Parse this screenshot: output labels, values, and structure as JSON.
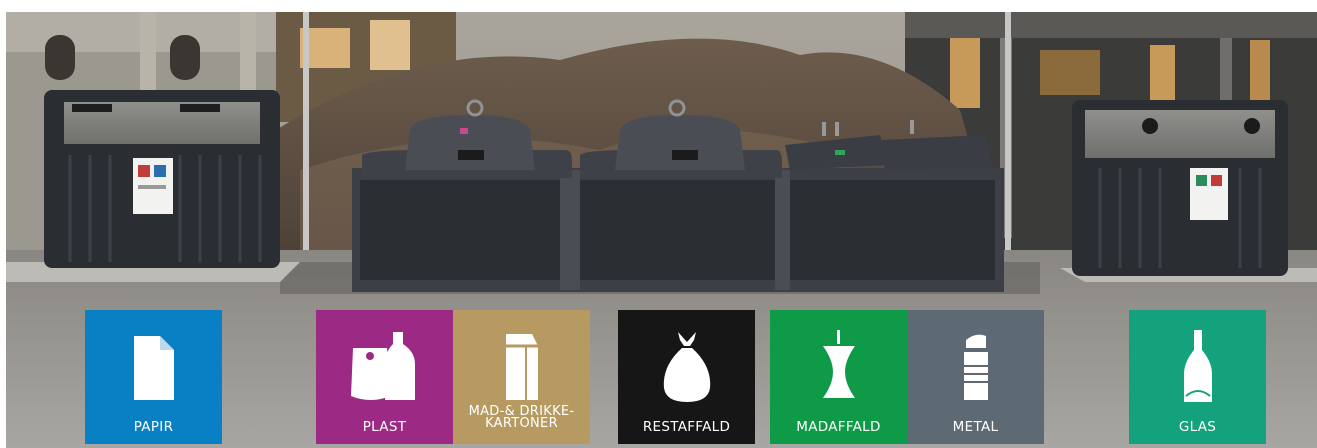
{
  "image": {
    "description_text": []
  },
  "colors": {
    "papir": "#0a80c4",
    "plast": "#9c2a84",
    "mad_drikkekartoner": "#b79a62",
    "restaffald": "#161616",
    "madaffald": "#0f9a48",
    "metal": "#5d6a73",
    "glas": "#14a27c"
  },
  "tiles": {
    "papir": {
      "label": "PAPIR",
      "icon": "paper-sheet-icon"
    },
    "plast": {
      "label": "PLAST",
      "icon": "plastic-bag-bottle-icon"
    },
    "kartoner": {
      "label": "MAD-& DRIKKE-\nKARTONER",
      "icon": "carton-icon"
    },
    "restaffald": {
      "label": "RESTAFFALD",
      "icon": "trash-bag-icon"
    },
    "madaffald": {
      "label": "MADAFFALD",
      "icon": "apple-core-icon"
    },
    "metal": {
      "label": "METAL",
      "icon": "tin-can-icon"
    },
    "glas": {
      "label": "GLAS",
      "icon": "glass-bottle-icon"
    }
  }
}
